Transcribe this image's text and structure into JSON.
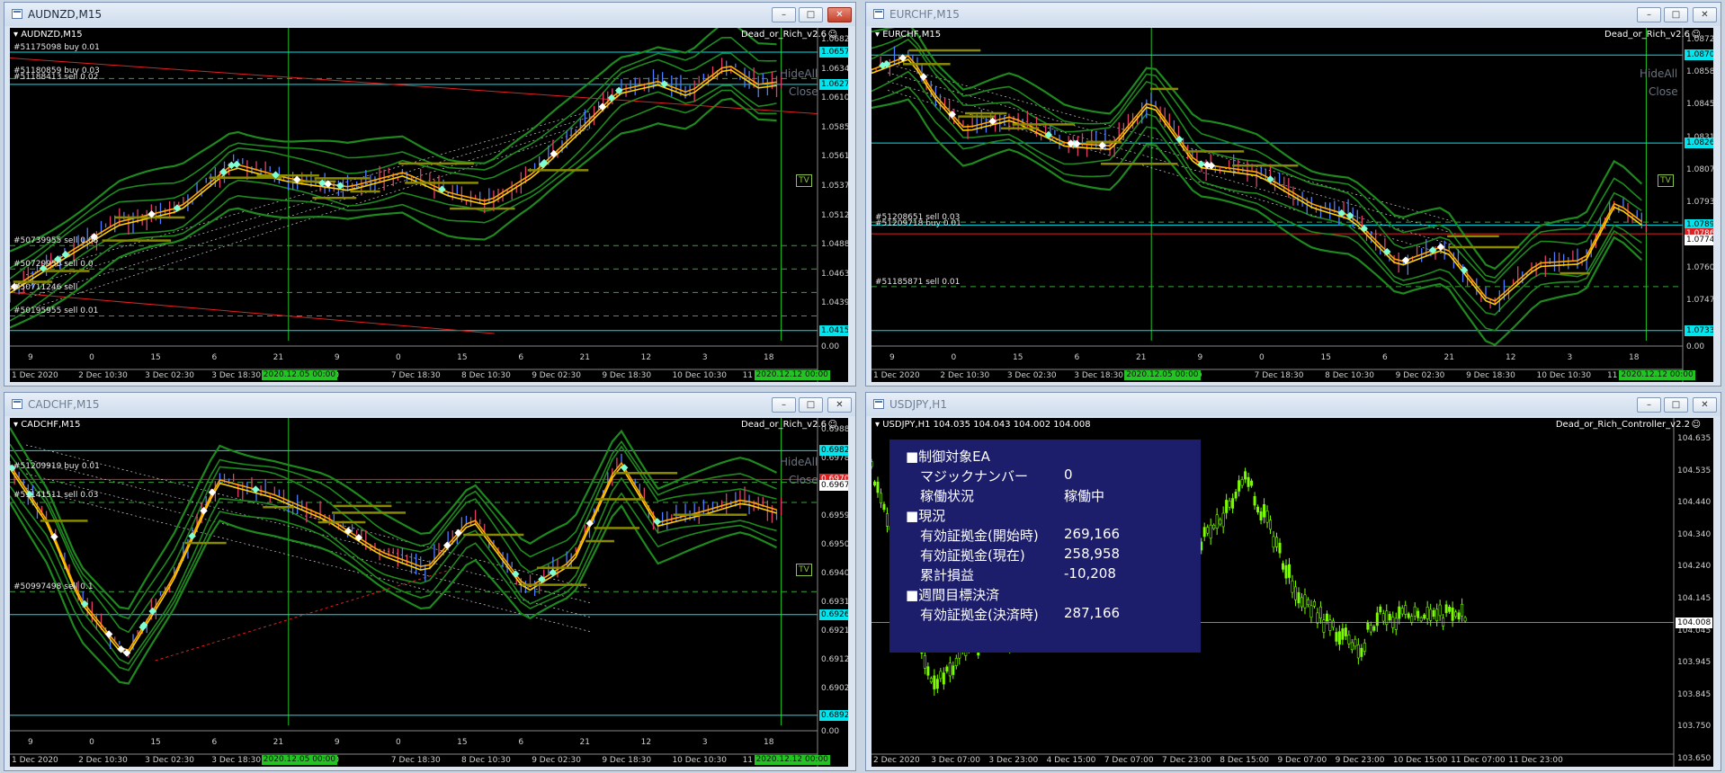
{
  "windows": [
    {
      "id": "audnzd",
      "title": "AUDNZD,M15",
      "symbol_label": "AUDNZD,M15",
      "ea_label": "Dead_or_Rich_v2.6",
      "buttons": [
        "HideAll",
        "Close"
      ],
      "tv_label": "TV",
      "orders": [
        "#51175098 buy 0.01",
        "#51180859 buy 0.03",
        "#51188413 sell 0.02",
        "#50739955 sell 0.08",
        "#50729950 sell 0.0",
        "#50711246 sell",
        "#50195955 sell 0.01"
      ],
      "price_scale": [
        "1.06820",
        "1.06345",
        "1.06100",
        "1.05855",
        "1.05610",
        "1.05370",
        "1.05125",
        "1.04880",
        "1.04635",
        "1.04390",
        "1.04145",
        "0.00"
      ],
      "price_boxes": [
        {
          "text": "1.06572",
          "color": "#00e5ee"
        },
        {
          "text": "1.06276",
          "color": "#00e5ee"
        },
        {
          "text": "1.04153",
          "color": "#00e5ee"
        }
      ],
      "indicator_numbers": [
        "9",
        "0",
        "15",
        "6",
        "21",
        "9",
        "0",
        "15",
        "6",
        "21",
        "12",
        "3",
        "18"
      ],
      "time_scale": [
        "1 Dec 2020",
        "2 Dec 10:30",
        "3 Dec 02:30",
        "3 Dec 18:30",
        "4 D",
        "2:30",
        "7 Dec 18:30",
        "8 Dec 10:30",
        "9 Dec 02:30",
        "9 Dec 18:30",
        "10 Dec 10:30",
        "11 Dec 02:"
      ],
      "separators": [
        "2020.12.05 00:00",
        "2020.12.12 00:00"
      ]
    },
    {
      "id": "eurchf",
      "title": "EURCHF,M15",
      "symbol_label": "EURCHF,M15",
      "ea_label": "Dead_or_Rich_v2.6",
      "buttons": [
        "HideAll",
        "Close"
      ],
      "tv_label": "TV",
      "orders": [
        "#51208651 sell 0.03",
        "#51209718 buy 0.01",
        "#51185871 sell 0.01"
      ],
      "price_scale": [
        "1.08725",
        "1.08580",
        "1.08455",
        "1.08315",
        "1.08075",
        "1.07935",
        "1.07740",
        "1.07605",
        "1.07470",
        "1.07335",
        "0.00"
      ],
      "price_boxes": [
        {
          "text": "1.08709",
          "color": "#00e5ee"
        },
        {
          "text": "1.08263",
          "color": "#00e5ee"
        },
        {
          "text": "1.07896",
          "color": "#00e5ee"
        },
        {
          "text": "1.07865",
          "color": "#e02020"
        },
        {
          "text": "1.07740",
          "color": "#ffffff"
        },
        {
          "text": "1.07339",
          "color": "#00e5ee"
        }
      ],
      "indicator_numbers": [
        "9",
        "0",
        "15",
        "6",
        "21",
        "9",
        "0",
        "15",
        "6",
        "21",
        "12",
        "3",
        "18"
      ],
      "time_scale": [
        "1 Dec 2020",
        "2 Dec 10:30",
        "3 Dec 02:30",
        "3 Dec 18:30",
        "4 D",
        "2:30",
        "7 Dec 18:30",
        "8 Dec 10:30",
        "9 Dec 02:30",
        "9 Dec 18:30",
        "10 Dec 10:30",
        "11 Dec 02:"
      ],
      "separators": [
        "2020.12.05 00:00",
        "2020.12.12 00:00"
      ]
    },
    {
      "id": "cadchf",
      "title": "CADCHF,M15",
      "symbol_label": "CADCHF,M15",
      "ea_label": "Dead_or_Rich_v2.6",
      "buttons": [
        "HideAll",
        "Close"
      ],
      "tv_label": "TV",
      "orders": [
        "#51209919 buy 0.01",
        "#51141511 sell 0.03",
        "#50997498 sell 0.1"
      ],
      "price_scale": [
        "0.69880",
        "0.69785",
        "0.69690",
        "0.69595",
        "0.69500",
        "0.69405",
        "0.69310",
        "0.69215",
        "0.69120",
        "0.69025",
        "0.68930",
        "0.00"
      ],
      "price_boxes": [
        {
          "text": "0.69821",
          "color": "#00e5ee"
        },
        {
          "text": "0.69708",
          "color": "#e02020"
        },
        {
          "text": "0.69677",
          "color": "#ffffff"
        },
        {
          "text": "0.69262",
          "color": "#00e5ee"
        },
        {
          "text": "0.68927",
          "color": "#00e5ee"
        }
      ],
      "indicator_numbers": [
        "9",
        "0",
        "15",
        "6",
        "21",
        "9",
        "0",
        "15",
        "6",
        "21",
        "12",
        "3",
        "18"
      ],
      "time_scale": [
        "1 Dec 2020",
        "2 Dec 10:30",
        "3 Dec 02:30",
        "3 Dec 18:30",
        "4 D",
        "2:30",
        "7 Dec 18:30",
        "8 Dec 10:30",
        "9 Dec 02:30",
        "9 Dec 18:30",
        "10 Dec 10:30",
        "11 Dec 02:"
      ],
      "separators": [
        "2020.12.05 00:00",
        "2020.12.12 00:00"
      ]
    },
    {
      "id": "usdjpy",
      "title": "USDJPY,H1",
      "symbol_label": "USDJPY,H1  104.035 104.043 104.002 104.008",
      "ea_label": "Dead_or_Rich_Controller_v2.2",
      "price_scale": [
        "104.635",
        "104.535",
        "104.440",
        "104.340",
        "104.240",
        "104.145",
        "104.045",
        "103.945",
        "103.845",
        "103.750",
        "103.650"
      ],
      "price_boxes": [
        {
          "text": "104.008",
          "color": "#ffffff"
        }
      ],
      "time_scale": [
        "2 Dec 2020",
        "3 Dec 07:00",
        "3 Dec 23:00",
        "4 Dec 15:00",
        "7 Dec 07:00",
        "7 Dec 23:00",
        "8 Dec 15:00",
        "9 Dec 07:00",
        "9 Dec 23:00",
        "10 Dec 15:00",
        "11 Dec 07:00",
        "11 Dec 23:00"
      ],
      "panel": {
        "sections": [
          {
            "heading": "■制御対象EA",
            "rows": [
              {
                "label": "マジックナンバー",
                "value": "0"
              },
              {
                "label": "稼働状況",
                "value": "稼働中"
              }
            ]
          },
          {
            "heading": "■現況",
            "rows": [
              {
                "label": "有効証拠金(開始時)",
                "value": "269,166"
              },
              {
                "label": "有効証拠金(現在)",
                "value": "258,958"
              },
              {
                "label": "累計損益",
                "value": "-10,208"
              }
            ]
          },
          {
            "heading": "■週間目標決済",
            "rows": [
              {
                "label": "有効証拠金(決済時)",
                "value": "287,166"
              }
            ]
          }
        ]
      }
    }
  ],
  "colors": {
    "chart_bg": "#000000",
    "band": "#1e8a1e",
    "ma_orange": "#ffa500",
    "separator_green": "#22c322",
    "cyan_line": "#00e5ee",
    "red_line": "#e02020",
    "order_olive": "#8a8a00",
    "panel_bg": "#1c1d6b",
    "candle_green": "#7cfc00"
  },
  "icons": [
    "window-icon",
    "minimize-icon",
    "maximize-icon",
    "close-icon",
    "chart-menu-arrow-icon",
    "smile-icon"
  ]
}
